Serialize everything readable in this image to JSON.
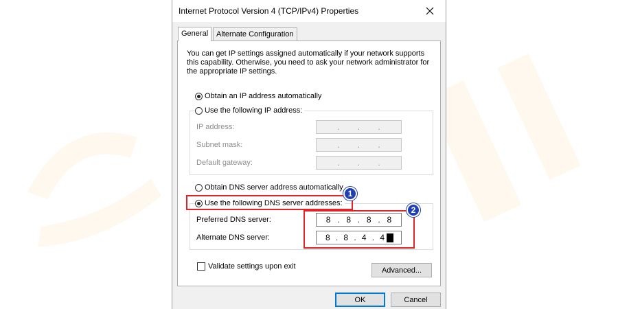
{
  "dialog": {
    "title": "Internet Protocol Version 4 (TCP/IPv4) Properties",
    "tabs": [
      {
        "label": "General",
        "active": true
      },
      {
        "label": "Alternate Configuration",
        "active": false
      }
    ],
    "description": "You can get IP settings assigned automatically if your network supports this capability. Otherwise, you need to ask your network administrator for the appropriate IP settings.",
    "ip": {
      "auto_label": "Obtain an IP address automatically",
      "manual_label": "Use the following IP address:",
      "fields": [
        {
          "label": "IP address:",
          "value": [
            "",
            "",
            "",
            ""
          ]
        },
        {
          "label": "Subnet mask:",
          "value": [
            "",
            "",
            "",
            ""
          ]
        },
        {
          "label": "Default gateway:",
          "value": [
            "",
            "",
            "",
            ""
          ]
        }
      ]
    },
    "dns": {
      "auto_label": "Obtain DNS server address automatically",
      "manual_label": "Use the following DNS server addresses:",
      "preferred_label": "Preferred DNS server:",
      "preferred_octets": [
        "8",
        "8",
        "8",
        "8"
      ],
      "alternate_label": "Alternate DNS server:",
      "alternate_octets": [
        "8",
        "8",
        "4",
        "4"
      ]
    },
    "validate_label": "Validate settings upon exit",
    "advanced_label": "Advanced...",
    "ok_label": "OK",
    "cancel_label": "Cancel"
  },
  "annotations": {
    "badge1": "1",
    "badge2": "2"
  },
  "colors": {
    "highlight": "#e32226",
    "badge": "#1f3fb3",
    "accent": "#0078d7"
  },
  "icons": [
    "close-icon",
    "radio-checked",
    "radio-unchecked",
    "checkbox-unchecked"
  ]
}
